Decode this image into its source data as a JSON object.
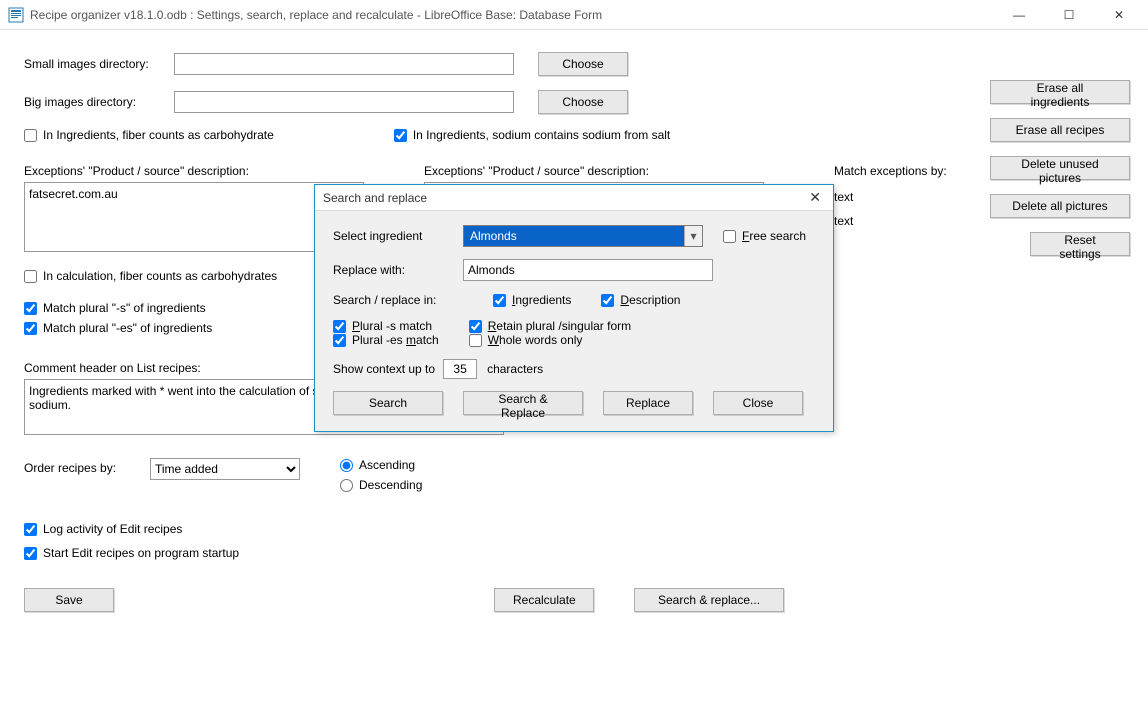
{
  "window": {
    "title": "Recipe organizer v18.1.0.odb : Settings, search, replace and recalculate - LibreOffice Base: Database Form"
  },
  "form": {
    "small_images_label": "Small images directory:",
    "small_images_value": "",
    "big_images_label": "Big images directory:",
    "big_images_value": "",
    "choose": "Choose",
    "fiber_carb_ing": "In Ingredients, fiber counts as carbohydrate",
    "sodium_salt": "In Ingredients, sodium contains sodium from salt",
    "exceptions_label": "Exceptions' \"Product / source\" description:",
    "exceptions_left": "fatsecret.com.au",
    "match_exceptions_by": "Match exceptions by:",
    "match_opt1": "text",
    "match_opt2": "text",
    "fiber_calc": "In calculation, fiber counts as carbohydrates",
    "match_plural_s": "Match plural \"-s\" of ingredients",
    "match_plural_es": "Match plural \"-es\" of ingredients",
    "comment_header_label": "Comment header on List recipes:",
    "comment_header_value": "Ingredients marked with * went into the calculation of sodium. 1 g salt contains 0.4 g sodium.",
    "order_by_label": "Order recipes by:",
    "order_by_value": "Time added",
    "ascending": "Ascending",
    "descending": "Descending",
    "log_activity": "Log activity of Edit recipes",
    "start_on_startup": "Start Edit recipes on program startup",
    "save": "Save",
    "recalculate": "Recalculate",
    "search_replace": "Search & replace..."
  },
  "sidebar": {
    "erase_ingredients": "Erase all ingredients",
    "erase_recipes": "Erase all recipes",
    "delete_unused": "Delete unused pictures",
    "delete_all": "Delete all pictures",
    "reset": "Reset settings"
  },
  "dialog": {
    "title": "Search and replace",
    "select_ingredient_label": "Select ingredient",
    "select_ingredient_value": "Almonds",
    "free_search": "Free search",
    "replace_with_label": "Replace with:",
    "replace_with_value": "Almonds",
    "search_replace_in": "Search / replace in:",
    "ingredients": "Ingredients",
    "description": "Description",
    "plural_s": "Plural -s match",
    "plural_es": "Plural -es match",
    "retain_plural": "Retain plural /singular form",
    "whole_words": "Whole words only",
    "context_pre": "Show context up to",
    "context_value": "35",
    "context_post": "characters",
    "search_btn": "Search",
    "search_replace_btn": "Search & Replace",
    "replace_btn": "Replace",
    "close_btn": "Close"
  }
}
